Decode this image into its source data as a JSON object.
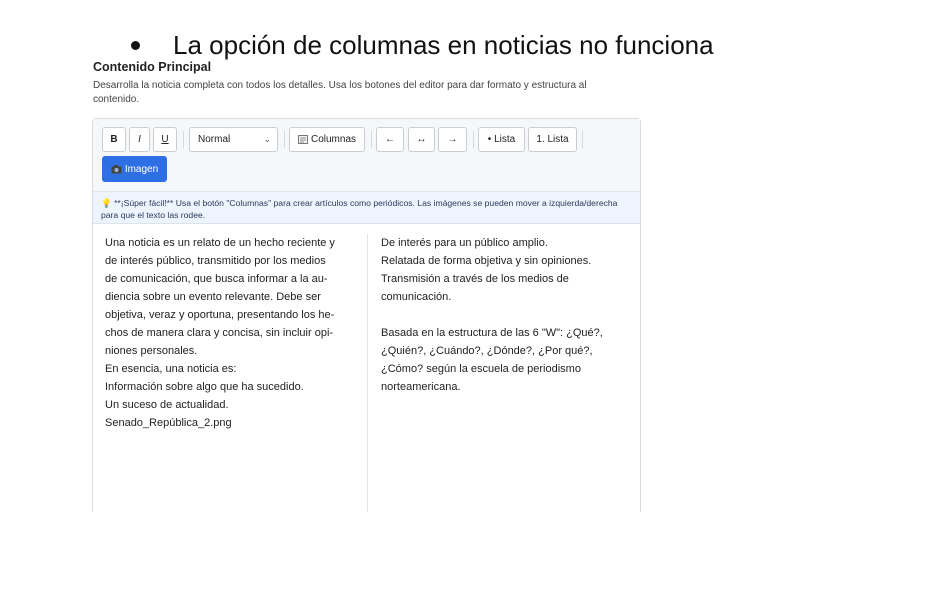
{
  "note": {
    "bullet_text": "La opción de columnas en noticias no funciona"
  },
  "section": {
    "title": "Contenido Principal",
    "description": "Desarrolla la noticia completa con todos los detalles. Usa los botones del editor para dar formato y estructura al contenido."
  },
  "toolbar": {
    "bold_label": "B",
    "italic_label": "I",
    "underline_label": "U",
    "format_select_value": "Normal",
    "columns_label": "Columnas",
    "align_left_label": "←",
    "align_center_label": "↔",
    "align_right_label": "→",
    "bullet_list_label": "• Lista",
    "numbered_list_label": "1. Lista",
    "image_label": "Imagen",
    "image_icon_color": "#2f6fe4"
  },
  "tip": {
    "text": "💡 **¡Súper fácil!** Usa el botón \"Columnas\" para crear artículos como periódicos. Las imágenes se pueden mover a izquierda/derecha para que el texto las rodee."
  },
  "content": {
    "left_column": "Una noticia es un relato de un hecho reciente y\nde interés público, transmitido por los medios\nde comunicación, que busca informar a la au-\ndiencia sobre un evento relevante. Debe ser\nobjetiva, veraz y oportuna, presentando los he-\nchos de manera clara y concisa, sin incluir opi-\nniones personales.\nEn esencia, una noticia es:\nInformación sobre algo que ha sucedido.\nUn suceso de actualidad.\nSenado_República_2.png",
    "right_column": "De interés para un público amplio.\nRelatada de forma objetiva y sin opiniones.\nTransmisión a través de los medios de\ncomunicación.\n\nBasada en la estructura de las 6 \"W\": ¿Qué?,\n¿Quién?, ¿Cuándo?, ¿Dónde?, ¿Por qué?,\n¿Cómo? según la escuela de periodismo\nnorteamericana."
  }
}
